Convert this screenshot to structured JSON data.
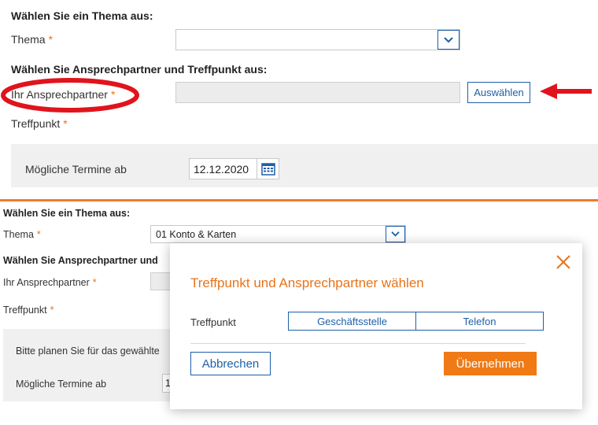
{
  "top": {
    "heading_theme": "Wählen Sie ein Thema aus:",
    "theme_label": "Thema",
    "theme_value": "",
    "heading_contact": "Wählen Sie Ansprechpartner und Treffpunkt aus:",
    "contact_label": "Ihr Ansprechpartner",
    "contact_value": "",
    "select_button": "Auswählen",
    "meeting_label": "Treffpunkt",
    "dates_label": "Mögliche Termine ab",
    "date_value": "12.12.2020",
    "required_mark": "*"
  },
  "bottom": {
    "heading_theme": "Wählen Sie ein Thema aus:",
    "theme_label": "Thema",
    "theme_value": "01 Konto & Karten",
    "heading_contact": "Wählen Sie Ansprechpartner und",
    "contact_label": "Ihr Ansprechpartner",
    "meeting_label": "Treffpunkt",
    "plan_text": "Bitte planen Sie für das gewählte",
    "dates_label": "Mögliche Termine ab",
    "date_partial": "1",
    "required_mark": "*"
  },
  "dialog": {
    "title": "Treffpunkt und Ansprechpartner wählen",
    "meeting_label": "Treffpunkt",
    "options": [
      "Geschäftsstelle",
      "Telefon"
    ],
    "cancel_label": "Abbrechen",
    "apply_label": "Übernehmen"
  },
  "colors": {
    "accent_orange": "#f07a16",
    "link_blue": "#1e5fa8",
    "annotation_red": "#e0141c"
  },
  "icons": {
    "dropdown": "chevron-down-icon",
    "calendar": "calendar-icon",
    "close": "close-icon",
    "annotation_arrow": "arrow-left-icon"
  }
}
